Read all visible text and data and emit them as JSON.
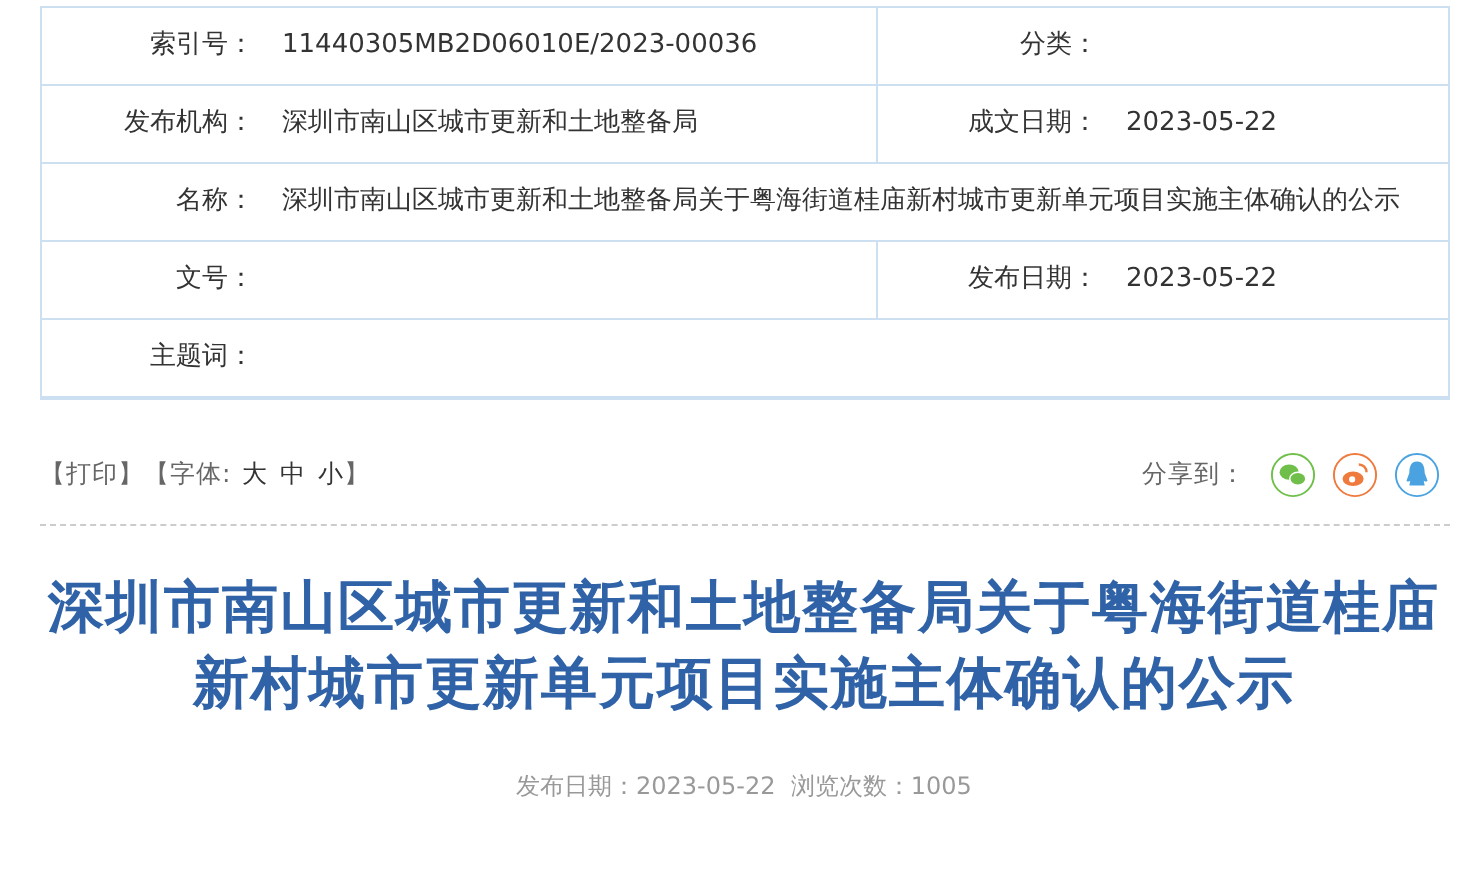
{
  "info_table": {
    "rows": [
      {
        "cells": [
          {
            "label": "索引号：",
            "value": "11440305MB2D06010E/2023-00036"
          },
          {
            "label": "分类："
          }
        ]
      },
      {
        "cells": [
          {
            "label": "发布机构：",
            "value": "深圳市南山区城市更新和土地整备局"
          },
          {
            "label": "成文日期：",
            "value": "2023-05-22"
          }
        ]
      },
      {
        "cells": [
          {
            "label": "名称：",
            "value": "深圳市南山区城市更新和土地整备局关于粤海街道桂庙新村城市更新单元项目实施主体确认的公示"
          }
        ]
      },
      {
        "cells": [
          {
            "label": "文号："
          },
          {
            "label": "发布日期：",
            "value": "2023-05-22"
          }
        ]
      },
      {
        "cells": [
          {
            "label": "主题词："
          }
        ]
      }
    ]
  },
  "toolbar": {
    "print": "【打印】",
    "font_label": "【字体:",
    "font_sizes": [
      "大",
      "中",
      "小"
    ],
    "font_close": "】",
    "share_label": "分享到：",
    "share": [
      {
        "kind": "wechat"
      },
      {
        "kind": "weibo"
      },
      {
        "kind": "qq"
      }
    ]
  },
  "article": {
    "title": "深圳市南山区城市更新和土地整备局关于粤海街道桂庙新村城市更新单元项目实施主体确认的公示",
    "meta": "发布日期：2023-05-22  浏览次数：1005"
  }
}
